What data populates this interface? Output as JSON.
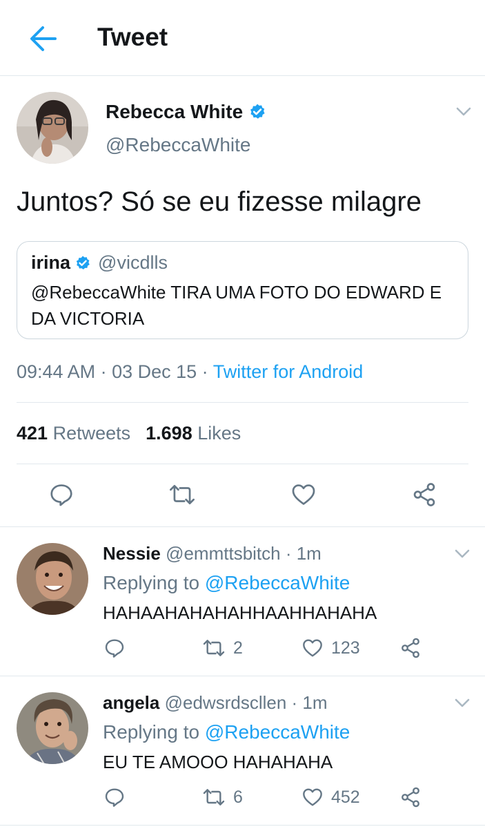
{
  "header": {
    "title": "Tweet"
  },
  "tweet": {
    "author_name": "Rebecca White",
    "author_handle": "@RebeccaWhite",
    "text": "Juntos? Só se eu fizesse milagre",
    "quote": {
      "name": "irina",
      "handle": "@vicdlls",
      "text": "@RebeccaWhite TIRA UMA FOTO DO EDWARD E DA VICTORIA"
    },
    "time": "09:44 AM",
    "date": "03 Dec 15",
    "separator": " · ",
    "source": "Twitter for Android",
    "retweets_count": "421",
    "retweets_label": "Retweets",
    "likes_count": "1.698",
    "likes_label": "Likes"
  },
  "replies": [
    {
      "name": "Nessie",
      "handle_time": "@emmttsbitch · 1m",
      "replying_prefix": "Replying to ",
      "replying_to": "@RebeccaWhite",
      "text": "HAHAAHAHAHAHHAAHHAHAHA",
      "retweets": "2",
      "likes": "123"
    },
    {
      "name": "angela",
      "handle_time": "@edwsrdscllen · 1m",
      "replying_prefix": "Replying to ",
      "replying_to": "@RebeccaWhite",
      "text": "EU TE AMOOO HAHAHAHA",
      "retweets": "6",
      "likes": "452"
    }
  ],
  "icons": {
    "back": "arrow-left-icon",
    "verified": "verified-badge-icon",
    "caret": "chevron-down-icon",
    "reply": "reply-icon",
    "retweet": "retweet-icon",
    "like": "heart-icon",
    "share": "share-icon"
  },
  "colors": {
    "accent": "#1da1f2",
    "secondary_text": "#657786",
    "primary_text": "#14171a",
    "divider": "#e1e8ed"
  }
}
